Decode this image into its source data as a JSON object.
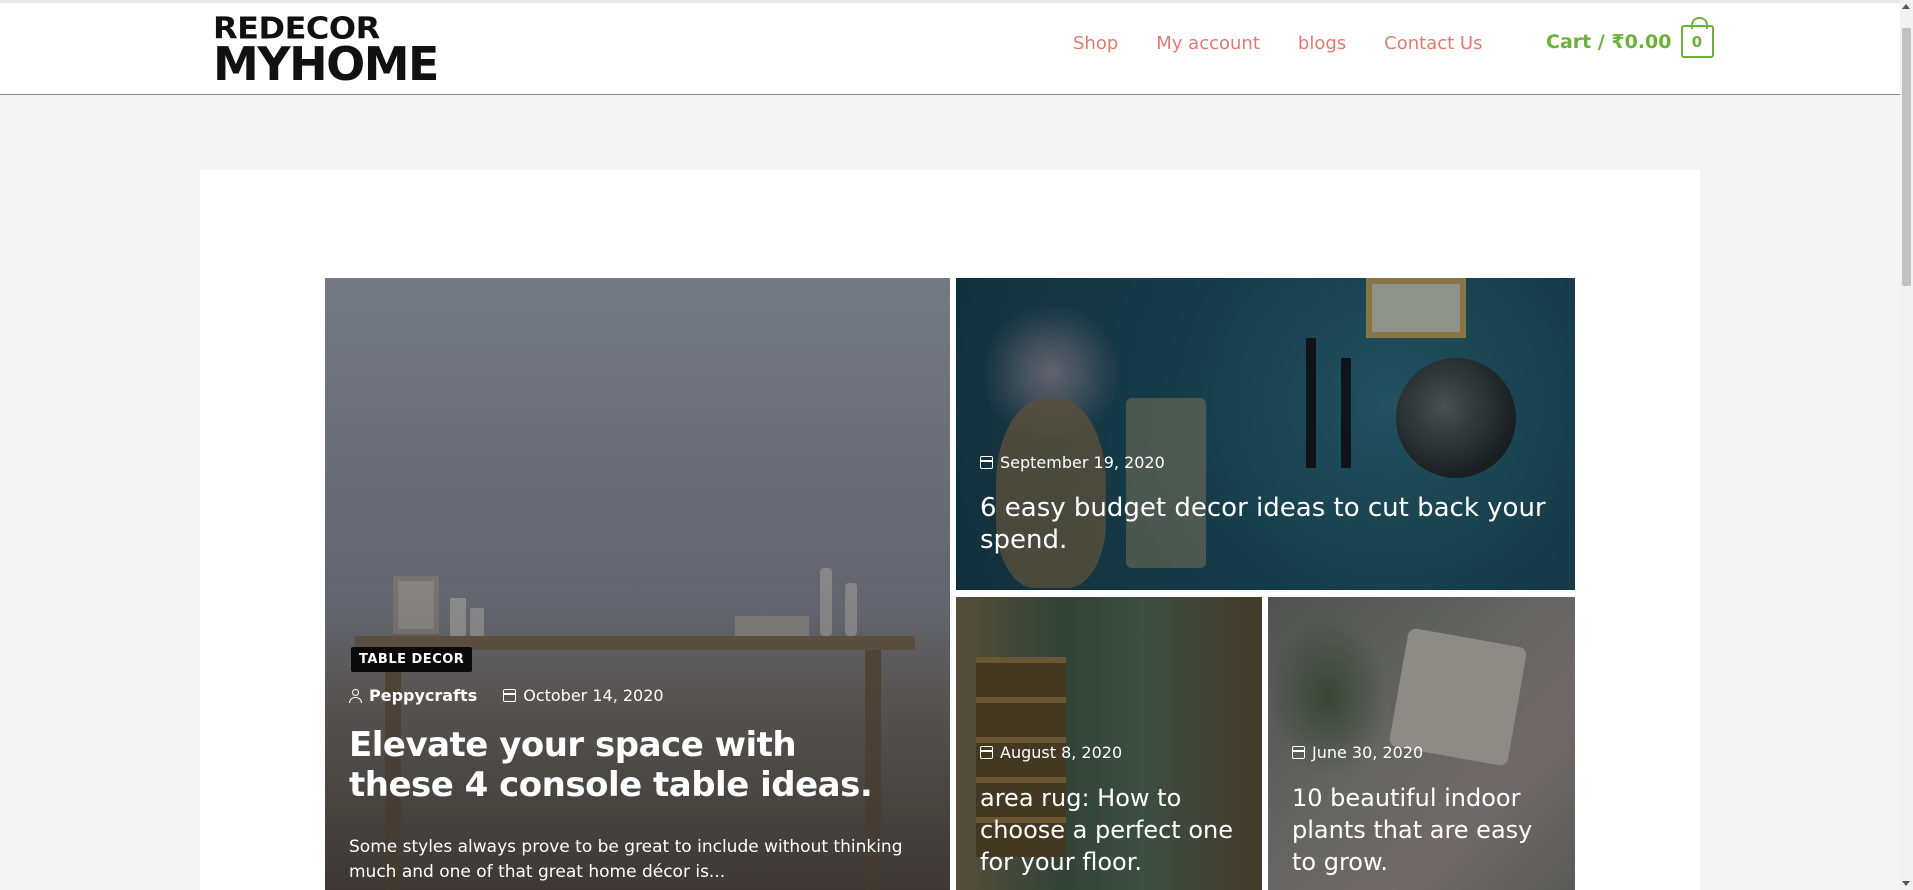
{
  "header": {
    "logo_line1": "REDECOR",
    "logo_line2": "MYHOME",
    "nav": [
      "Shop",
      "My account",
      "blogs",
      "Contact Us"
    ],
    "cart_label": "Cart / ₹0.00",
    "cart_count": "0"
  },
  "colors": {
    "nav_link": "#e07a72",
    "cart_accent": "#6bb13a",
    "page_background": "#f4f4f4",
    "card_background": "#ffffff"
  },
  "posts": {
    "featured": {
      "category": "TABLE DECOR",
      "author": "Peppycrafts",
      "date": "October 14, 2020",
      "title": "Elevate your space with these 4 console table ideas.",
      "excerpt": "Some styles always prove to be great to include without thinking much and one of that great home décor is..."
    },
    "top_right": {
      "date": "September 19, 2020",
      "title": "6 easy budget decor ideas to cut back your spend."
    },
    "bottom_left": {
      "date": "August 8, 2020",
      "title": "area rug: How to choose a perfect one for your floor."
    },
    "bottom_right": {
      "date": "June 30, 2020",
      "title": "10 beautiful indoor plants that are easy to grow."
    }
  },
  "icons": {
    "author": "user-icon",
    "date": "calendar-icon",
    "cart": "shopping-bag-icon"
  }
}
